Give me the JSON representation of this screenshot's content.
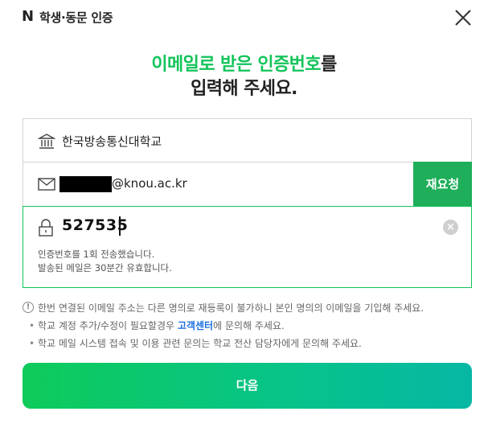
{
  "header": {
    "logo": "N",
    "title": "학생·동문 인증",
    "close_icon": "close-icon"
  },
  "headline": {
    "line1_green": "이메일로 받은 인증번호",
    "line1_dark": "를",
    "line2": "입력해 주세요."
  },
  "form": {
    "school": {
      "icon": "school-building-icon",
      "value": "한국방송통신대학교"
    },
    "email": {
      "icon": "mail-icon",
      "domain": "@knou.ac.kr",
      "resend_label": "재요청"
    },
    "code": {
      "icon": "lock-icon",
      "value": "527535",
      "info_line1": "인증번호를 1회 전송했습니다.",
      "info_line2": "발송된 메일은 30분간 유효합니다.",
      "clear_icon": "clear-icon"
    }
  },
  "notices": {
    "main": "한번 연결된 이메일 주소는 다른 명의로 재등록이 불가하니 본인 명의의 이메일을 기입해 주세요.",
    "bullet1_pre": "학교 계정 추가/수정이 필요할경우 ",
    "bullet1_link": "고객센터",
    "bullet1_post": "에 문의해 주세요.",
    "bullet2": "학교 메일 시스템 접속 및 이용 관련 문의는 학교 전산 담당자에게 문의해 주세요."
  },
  "next_button": "다음",
  "colors": {
    "brand_green": "#12c45a",
    "resend_green": "#1fae5a",
    "link_blue": "#1a6ee0"
  }
}
